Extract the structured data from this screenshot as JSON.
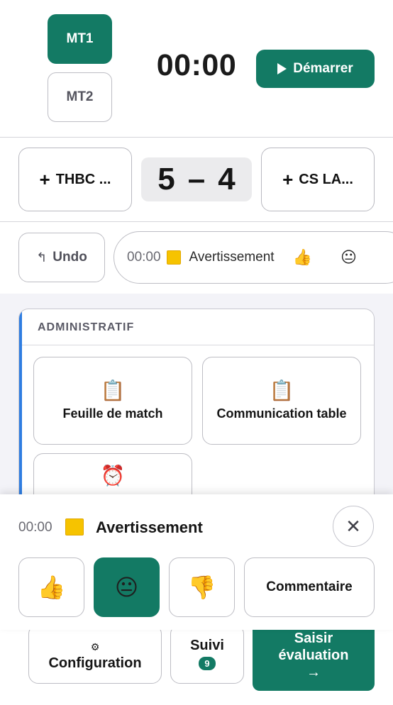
{
  "match": {
    "half_1": "MT1",
    "half_2": "MT2",
    "timer": "00:00",
    "start_label": "Démarrer"
  },
  "teams": {
    "home": {
      "plus": "+",
      "name": "THBC ..."
    },
    "away": {
      "plus": "+",
      "name": "CS LA..."
    },
    "score_home": "5",
    "score_sep": "–",
    "score_away": "4"
  },
  "history": {
    "undo_icon": "↰",
    "undo_label": "Undo",
    "last_event": {
      "time": "00:00",
      "card_icon": "yellow-card",
      "label": "Avertissement",
      "emoji_1": "👍",
      "emoji_2": "😐"
    }
  },
  "admin": {
    "title": "ADMINISTRATIF",
    "tiles": [
      {
        "icon": "📋",
        "label": "Feuille de match"
      },
      {
        "icon": "📋",
        "label": "Communication table"
      },
      {
        "icon": "⏰",
        "label": ""
      }
    ]
  },
  "nav": {
    "config_icon": "⚙",
    "config_label": "Configuration",
    "suivi_label": "Suivi",
    "suivi_count": "9",
    "eval_label_1": "Saisir",
    "eval_label_2": "évaluation",
    "eval_arrow": "→"
  },
  "sheet": {
    "time": "00:00",
    "card_icon": "yellow-card",
    "title": "Avertissement",
    "close": "✕",
    "thumbs_up": "👍",
    "neutral": "😐",
    "thumbs_down": "👎",
    "comment_label": "Commentaire",
    "selected": "neutral"
  },
  "colors": {
    "primary": "#137a64",
    "accent_blue": "#2f7de1",
    "yellow_card": "#f6c300"
  }
}
